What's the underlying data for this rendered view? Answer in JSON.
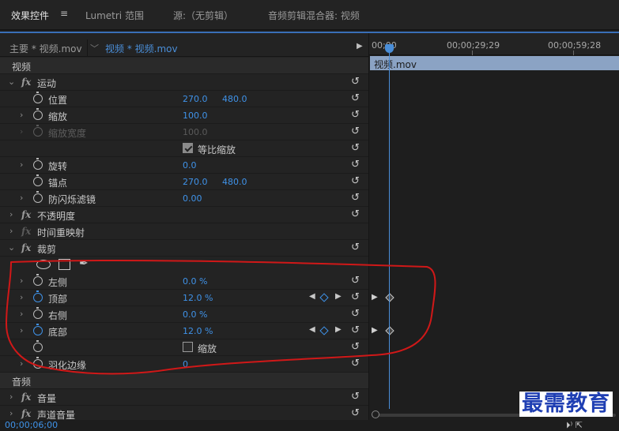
{
  "tabs": {
    "effect_controls": "效果控件",
    "menu_icon": "≡",
    "lumetri": "Lumetri 范围",
    "source": "源:（无剪辑）",
    "audio_mixer": "音频剪辑混合器: 视频"
  },
  "clipbar": {
    "master": "主要 * 视频.mov",
    "chevron": "﹀",
    "sequence": "视频 * 视频.mov",
    "play": "▶"
  },
  "sections": {
    "video": "视频",
    "audio": "音频"
  },
  "effects": {
    "motion": {
      "name": "运动",
      "position": {
        "label": "位置",
        "x": "270.0",
        "y": "480.0"
      },
      "scale": {
        "label": "缩放",
        "value": "100.0"
      },
      "scale_width": {
        "label": "缩放宽度",
        "value": "100.0"
      },
      "uniform_scale": {
        "label": "等比缩放"
      },
      "rotation": {
        "label": "旋转",
        "value": "0.0"
      },
      "anchor": {
        "label": "锚点",
        "x": "270.0",
        "y": "480.0"
      },
      "antiflicker": {
        "label": "防闪烁滤镜",
        "value": "0.00"
      }
    },
    "opacity": {
      "name": "不透明度"
    },
    "time_remap": {
      "name": "时间重映射"
    },
    "crop": {
      "name": "裁剪",
      "left": {
        "label": "左侧",
        "value": "0.0 %"
      },
      "top": {
        "label": "顶部",
        "value": "12.0 %"
      },
      "right": {
        "label": "右侧",
        "value": "0.0 %"
      },
      "bottom": {
        "label": "底部",
        "value": "12.0 %"
      },
      "zoom": {
        "label": "缩放"
      },
      "feather": {
        "label": "羽化边缘",
        "value": "0"
      }
    },
    "volume": {
      "name": "音量"
    },
    "channel_volume": {
      "name": "声道音量"
    }
  },
  "icons": {
    "twirl_closed": "›",
    "twirl_open": "⌄",
    "fx": "fx",
    "reset": "↺",
    "kf_prev": "◀",
    "kf_next": "▶",
    "pen": "✒",
    "tl_tri": "▶"
  },
  "timeline": {
    "tick_start": "00;00",
    "tick_mid": "00;00;29;29",
    "tick_end": "00;00;59;28",
    "clip_name": "视频.mov"
  },
  "status": {
    "time": "00;00;06;00",
    "icons": "⏵⁾  ⇱"
  },
  "watermark": "最需教育",
  "colors": {
    "accent_blue": "#3f92e8",
    "clip_block": "#8ba3c4",
    "annotation_red": "#d01818"
  }
}
